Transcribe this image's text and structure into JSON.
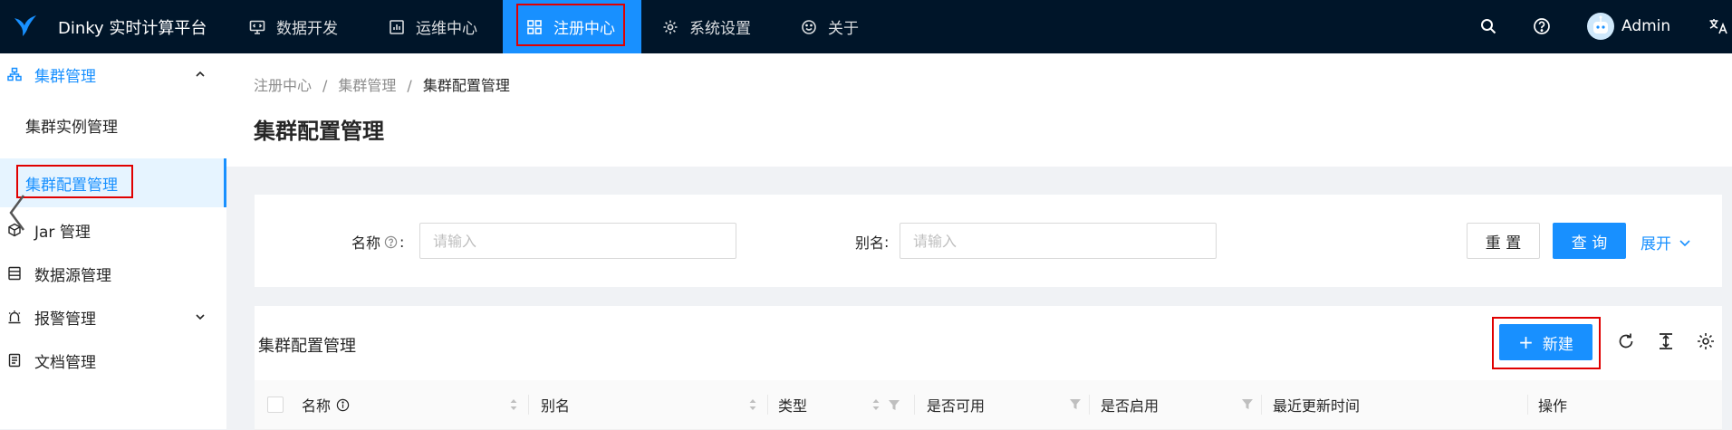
{
  "header": {
    "app_title": "Dinky 实时计算平台",
    "menu": [
      {
        "label": "数据开发",
        "icon": "monitor-code-icon"
      },
      {
        "label": "运维中心",
        "icon": "dashboard-icon"
      },
      {
        "label": "注册中心",
        "icon": "appstore-icon",
        "active": true
      },
      {
        "label": "系统设置",
        "icon": "gear-icon"
      },
      {
        "label": "关于",
        "icon": "smile-icon"
      }
    ],
    "user_name": "Admin",
    "accent_color": "#1890ff",
    "background_color": "#001529"
  },
  "sidebar": {
    "group_label": "集群管理",
    "sub_items": [
      "集群实例管理",
      "集群配置管理"
    ],
    "items": [
      {
        "label": "Jar 管理",
        "icon": "code-sandbox-icon"
      },
      {
        "label": "数据源管理",
        "icon": "database-icon"
      },
      {
        "label": "报警管理",
        "icon": "alert-icon"
      },
      {
        "label": "文档管理",
        "icon": "file-text-icon"
      }
    ]
  },
  "breadcrumb": [
    "注册中心",
    "集群管理",
    "集群配置管理"
  ],
  "breadcrumb_separator": "/",
  "page_title": "集群配置管理",
  "search_form": {
    "name_label": "名称",
    "alias_label": "别名",
    "colon": ":",
    "alias_colon": ":",
    "name_placeholder": "请输入",
    "alias_placeholder": "请输入",
    "reset_label": "重 置",
    "query_label": "查 询",
    "expand_label": "展开"
  },
  "table": {
    "title": "集群配置管理",
    "new_button_label": "新建",
    "new_button_plus": "+",
    "columns": [
      "名称",
      "别名",
      "类型",
      "是否可用",
      "是否启用",
      "最近更新时间",
      "操作"
    ]
  }
}
